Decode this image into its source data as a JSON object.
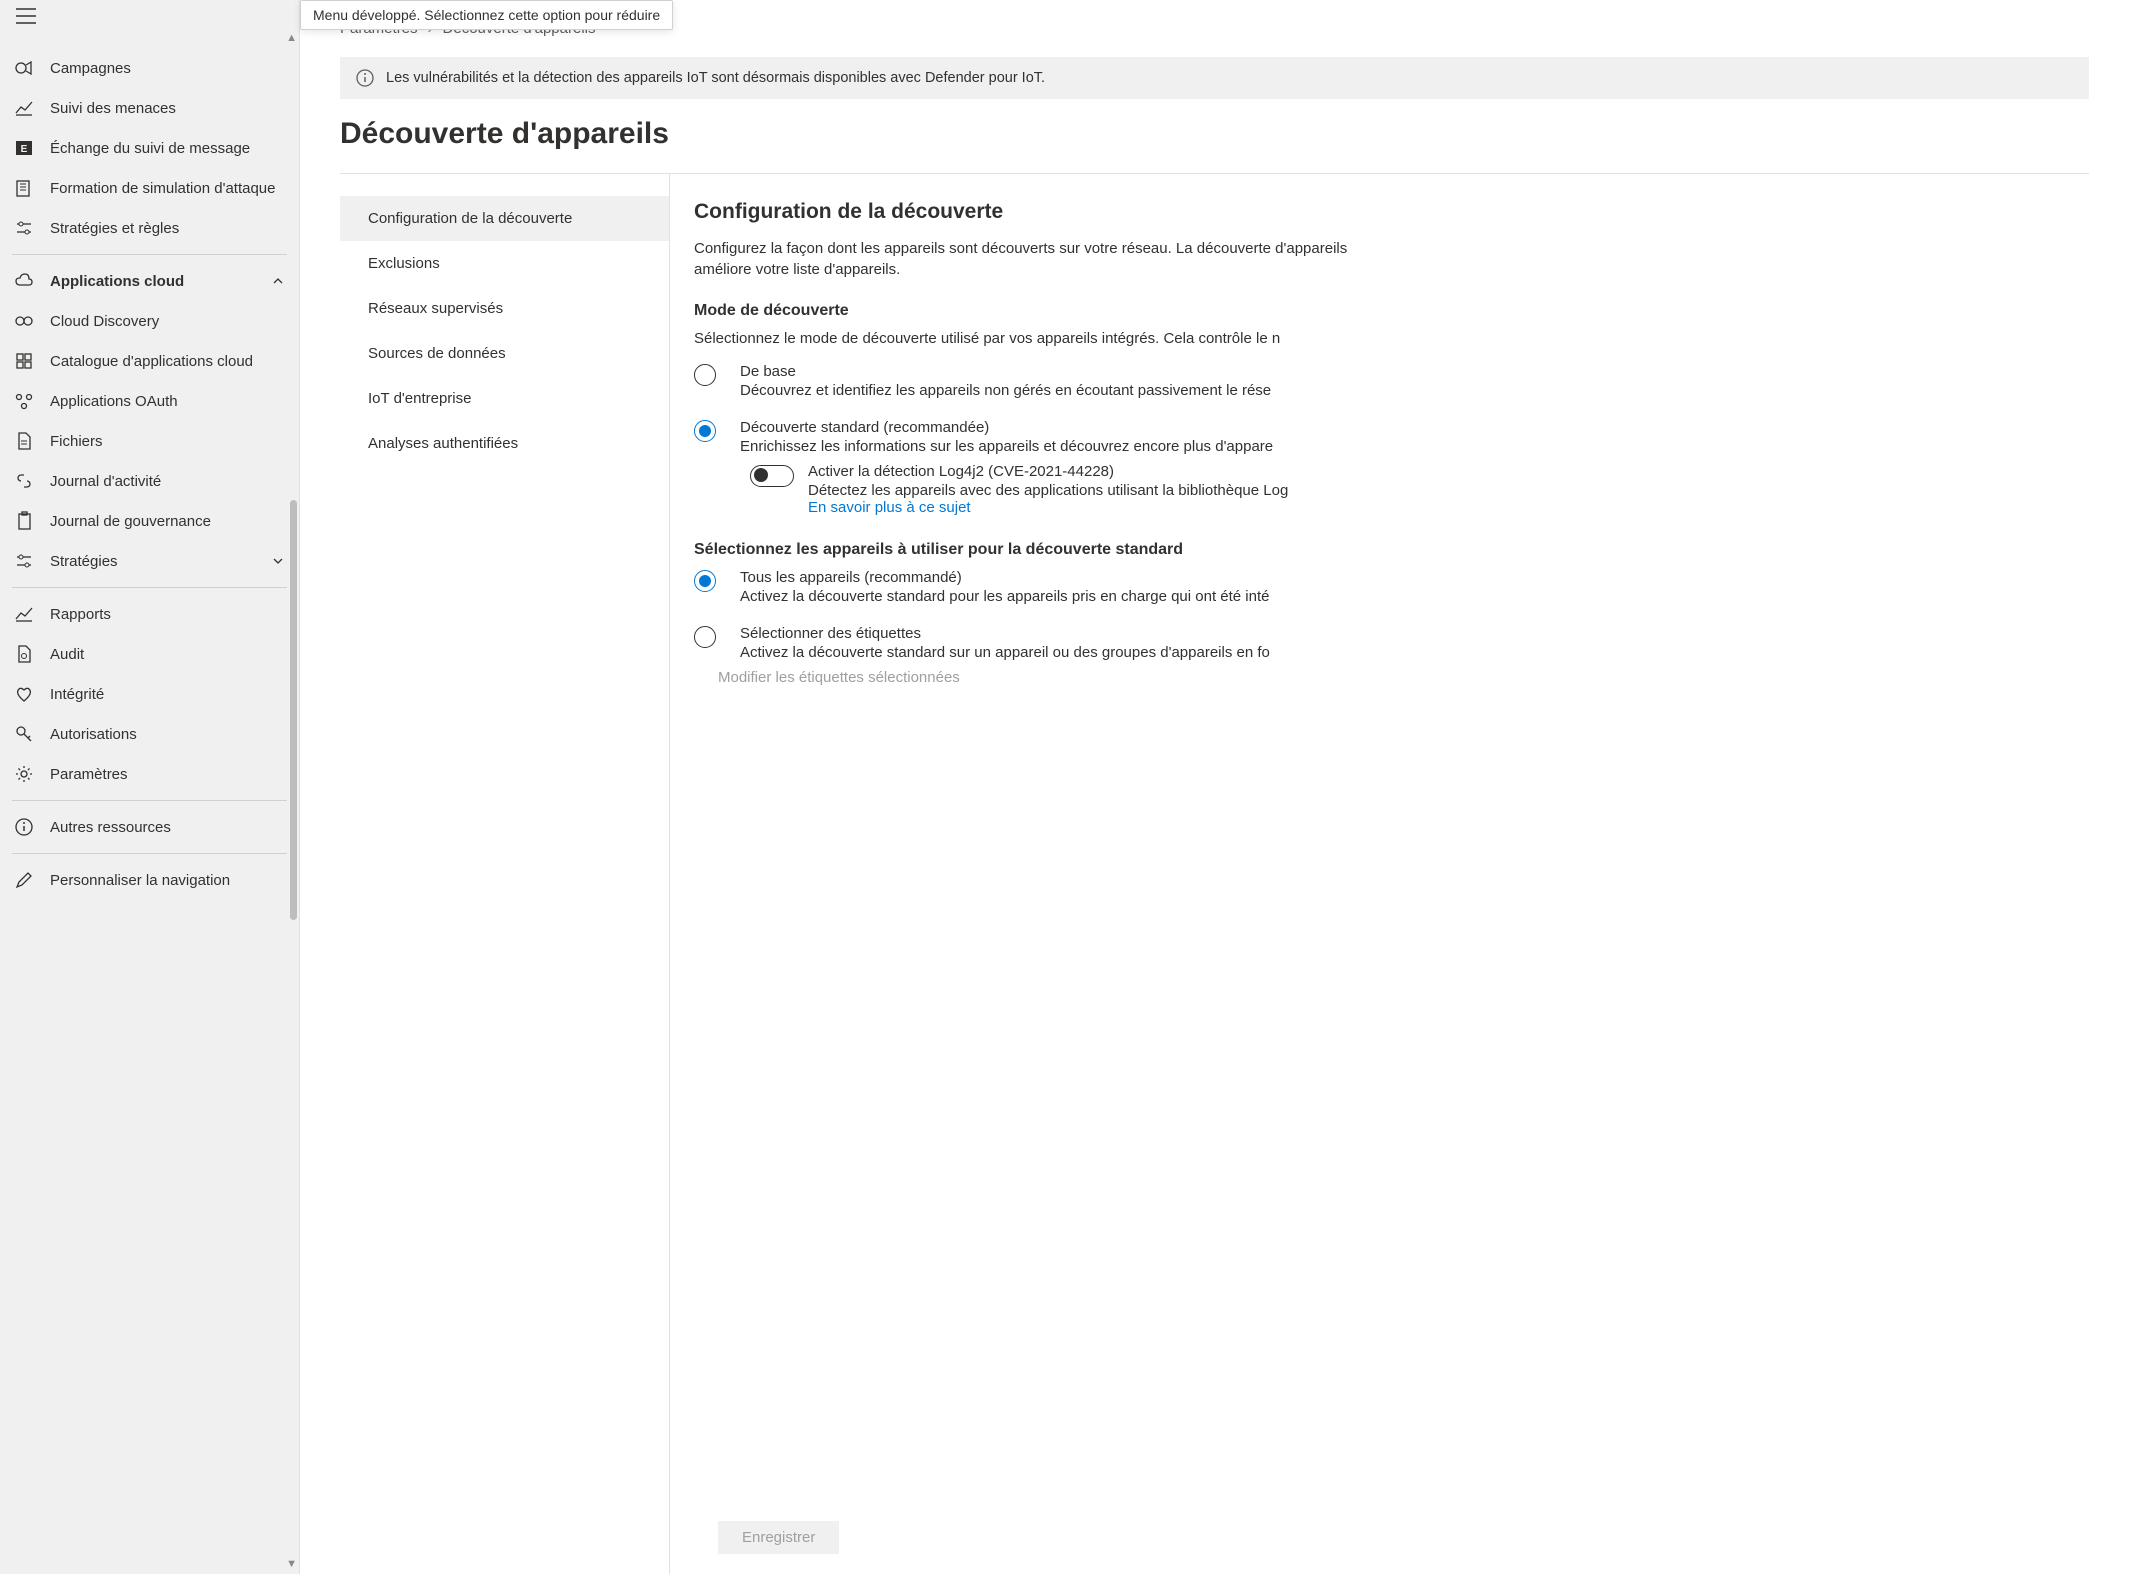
{
  "tooltip": "Menu développé. Sélectionnez cette option pour réduire",
  "sidebar": {
    "items1": [
      {
        "label": "Campagnes"
      },
      {
        "label": "Suivi des menaces"
      },
      {
        "label": "Échange du suivi de message"
      },
      {
        "label": "Formation de simulation d'attaque"
      },
      {
        "label": "Stratégies et règles"
      }
    ],
    "sectionHeader": "Applications cloud",
    "items2": [
      {
        "label": "Cloud Discovery"
      },
      {
        "label": "Catalogue d'applications cloud"
      },
      {
        "label": "Applications OAuth"
      },
      {
        "label": "Fichiers"
      },
      {
        "label": "Journal d'activité"
      },
      {
        "label": "Journal de gouvernance"
      },
      {
        "label": "Stratégies"
      }
    ],
    "items3": [
      {
        "label": "Rapports"
      },
      {
        "label": "Audit"
      },
      {
        "label": "Intégrité"
      },
      {
        "label": "Autorisations"
      },
      {
        "label": "Paramètres"
      }
    ],
    "items4": [
      {
        "label": "Autres ressources"
      }
    ],
    "items5": [
      {
        "label": "Personnaliser la navigation"
      }
    ]
  },
  "breadcrumb": {
    "a": "Paramètres",
    "b": "Découverte d'appareils"
  },
  "infoBar": "Les vulnérabilités et la détection des appareils IoT sont désormais disponibles avec Defender pour IoT.",
  "pageTitle": "Découverte d'appareils",
  "subnav": [
    "Configuration de la découverte",
    "Exclusions",
    "Réseaux supervisés",
    "Sources de données",
    "IoT d'entreprise",
    "Analyses authentifiées"
  ],
  "panel": {
    "title": "Configuration de la découverte",
    "desc": "Configurez la façon dont les appareils sont découverts sur votre réseau. La découverte d'appareils améliore votre liste d'appareils.",
    "modeTitle": "Mode de découverte",
    "modeDesc": "Sélectionnez le mode de découverte utilisé par vos appareils intégrés. Cela contrôle le n",
    "radio1": {
      "label": "De base",
      "desc": "Découvrez et identifiez les appareils non gérés en écoutant passivement le rése"
    },
    "radio2": {
      "label": "Découverte standard (recommandée)",
      "desc": "Enrichissez les informations sur les appareils et découvrez encore plus d'appare"
    },
    "toggle": {
      "label": "Activer la détection Log4j2 (CVE-2021-44228)",
      "desc": "Détectez les appareils avec des applications utilisant la bibliothèque Log",
      "link": "En savoir plus à ce sujet"
    },
    "selectTitle": "Sélectionnez les appareils à utiliser pour la découverte standard",
    "radio3": {
      "label": "Tous les appareils (recommandé)",
      "desc": "Activez la découverte standard pour les appareils pris en charge qui ont été inté"
    },
    "radio4": {
      "label": "Sélectionner des étiquettes",
      "desc": "Activez la découverte standard sur un appareil ou des groupes d'appareils en fo"
    },
    "editTags": "Modifier les étiquettes sélectionnées",
    "save": "Enregistrer"
  }
}
